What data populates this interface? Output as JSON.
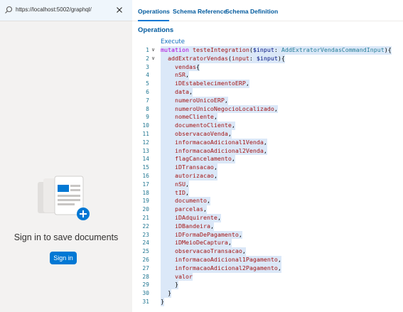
{
  "search": {
    "url": "https://localhost:5002/graphql/"
  },
  "left": {
    "signin_prompt": "Sign in to save documents",
    "signin_button": "Sign in"
  },
  "tabs": [
    {
      "label": "Operations",
      "active": true
    },
    {
      "label": "Schema Reference",
      "active": false
    },
    {
      "label": "Schema Definition",
      "active": false
    }
  ],
  "section_title": "Operations",
  "execute_label": "Execute",
  "code": {
    "line_numbers": [
      "1",
      "2",
      "3",
      "4",
      "5",
      "6",
      "7",
      "8",
      "9",
      "10",
      "11",
      "12",
      "13",
      "14",
      "15",
      "16",
      "17",
      "18",
      "19",
      "20",
      "21",
      "22",
      "23",
      "24",
      "25",
      "26",
      "27",
      "28",
      "29",
      "30",
      "31"
    ],
    "lines": [
      "mutation testeIntegration($input: AddExtratorVendasCommandInput){",
      "  addExtratorVendas(input: $input){",
      "    vendas{",
      "    nSR,",
      "    iDEstabelecimentoERP,",
      "    data,",
      "    numeroUnicoERP,",
      "    numeroUnicoNegocioLocalizado,",
      "    nomeCliente,",
      "    documentoCliente,",
      "    observacaoVenda,",
      "    informacaoAdicional1Venda,",
      "    informacaoAdicional2Venda,",
      "    flagCancelamento,",
      "    iDTransacao,",
      "    autorizacao,",
      "    nSU,",
      "    tID,",
      "    documento,",
      "    parcelas,",
      "    iDAdquirente,",
      "    iDBandeira,",
      "    iDFormaDePagamento,",
      "    iDMeioDeCaptura,",
      "    observacaoTransacao,",
      "    informacaoAdicional1Pagamento,",
      "    informacaoAdicional2Pagamento,",
      "    valor",
      "    }",
      "  }",
      "}"
    ]
  },
  "colors": {
    "accent": "#0078d4",
    "tab_text": "#005a9e",
    "line_number": "#237893",
    "selection": "#dbe8f8"
  }
}
